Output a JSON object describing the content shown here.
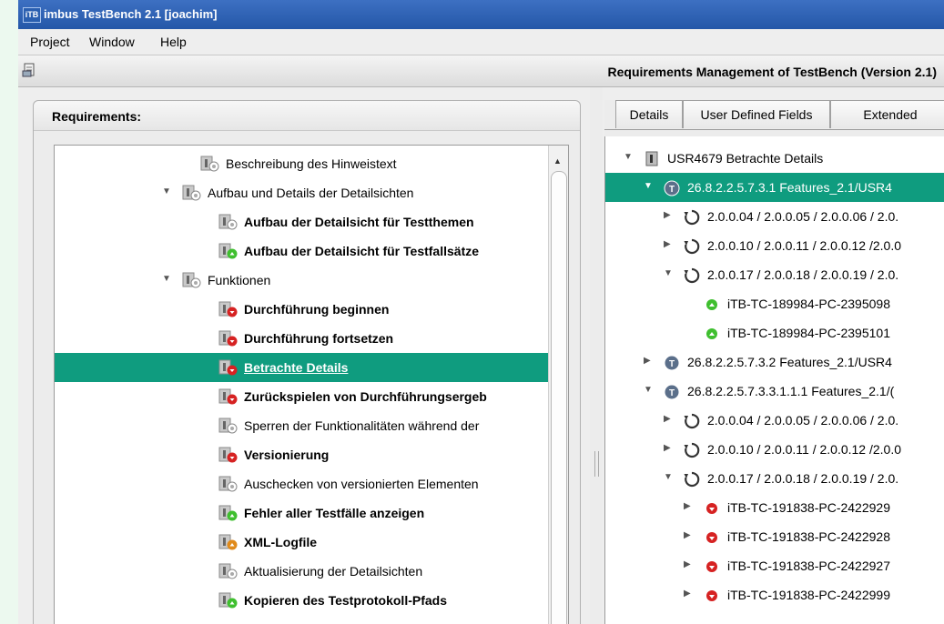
{
  "window": {
    "app_icon": "iTB",
    "title": "imbus TestBench 2.1 [joachim]"
  },
  "menu": [
    "Project",
    "Window",
    "Help"
  ],
  "header": {
    "icon": "document-icon",
    "title": "Requirements Management of TestBench (Version 2.1)"
  },
  "left_panel": {
    "title": "Requirements:",
    "items": [
      {
        "label": "Beschreibung des Hinweistext",
        "status": "gray",
        "bold": false,
        "expander": ""
      },
      {
        "label": "Aufbau und Details der Detailsichten",
        "status": "gray",
        "bold": false,
        "expander": "expanded"
      },
      {
        "label": "Aufbau der Detailsicht für Testthemen",
        "status": "gray",
        "bold": true,
        "expander": ""
      },
      {
        "label": "Aufbau der Detailsicht für Testfallsätze",
        "status": "green",
        "bold": true,
        "expander": ""
      },
      {
        "label": "Funktionen",
        "status": "gray",
        "bold": false,
        "expander": "expanded"
      },
      {
        "label": "Durchführung beginnen",
        "status": "red",
        "bold": true,
        "expander": ""
      },
      {
        "label": "Durchführung fortsetzen",
        "status": "red",
        "bold": true,
        "expander": ""
      },
      {
        "label": "Betrachte Details",
        "status": "red",
        "bold": true,
        "expander": "",
        "selected": true
      },
      {
        "label": "Zurückspielen von Durchführungsergeb",
        "status": "red",
        "bold": true,
        "expander": ""
      },
      {
        "label": "Sperren der Funktionalitäten während der",
        "status": "gray",
        "bold": false,
        "expander": ""
      },
      {
        "label": "Versionierung",
        "status": "red",
        "bold": true,
        "expander": ""
      },
      {
        "label": "Auschecken von versionierten Elementen",
        "status": "gray",
        "bold": false,
        "expander": ""
      },
      {
        "label": "Fehler aller Testfälle anzeigen",
        "status": "green",
        "bold": true,
        "expander": ""
      },
      {
        "label": "XML-Logfile",
        "status": "orange",
        "bold": true,
        "expander": ""
      },
      {
        "label": "Aktualisierung der Detailsichten",
        "status": "gray",
        "bold": false,
        "expander": ""
      },
      {
        "label": "Kopieren des Testprotokoll-Pfads",
        "status": "green",
        "bold": true,
        "expander": ""
      }
    ]
  },
  "right_panel": {
    "tabs": [
      "Details",
      "User Defined Fields",
      "Extended"
    ],
    "items": [
      {
        "label": "USR4679 Betrachte Details",
        "icon": "requirement",
        "expander": "expanded"
      },
      {
        "label": "26.8.2.2.5.7.3.1 Features_2.1/USR4",
        "icon": "topic",
        "expander": "expanded",
        "selected": true
      },
      {
        "label": "2.0.0.04 / 2.0.0.05 / 2.0.0.06 / 2.0.",
        "icon": "cycle",
        "expander": "collapsed"
      },
      {
        "label": "2.0.0.10 / 2.0.0.11 / 2.0.0.12 /2.0.0",
        "icon": "cycle",
        "expander": "collapsed"
      },
      {
        "label": "2.0.0.17 / 2.0.0.18 / 2.0.0.19 / 2.0.",
        "icon": "cycle",
        "expander": "expanded"
      },
      {
        "label": "iTB-TC-189984-PC-2395098",
        "icon": "green",
        "expander": ""
      },
      {
        "label": "iTB-TC-189984-PC-2395101",
        "icon": "green",
        "expander": ""
      },
      {
        "label": "26.8.2.2.5.7.3.2 Features_2.1/USR4",
        "icon": "topic",
        "expander": "collapsed"
      },
      {
        "label": "26.8.2.2.5.7.3.3.1.1.1 Features_2.1/(",
        "icon": "topic",
        "expander": "expanded"
      },
      {
        "label": "2.0.0.04 / 2.0.0.05 / 2.0.0.06 / 2.0.",
        "icon": "cycle",
        "expander": "collapsed"
      },
      {
        "label": "2.0.0.10 / 2.0.0.11 / 2.0.0.12 /2.0.0",
        "icon": "cycle",
        "expander": "collapsed"
      },
      {
        "label": "2.0.0.17 / 2.0.0.18 / 2.0.0.19 / 2.0.",
        "icon": "cycle",
        "expander": "expanded"
      },
      {
        "label": "iTB-TC-191838-PC-2422929",
        "icon": "red",
        "expander": "collapsed"
      },
      {
        "label": "iTB-TC-191838-PC-2422928",
        "icon": "red",
        "expander": "collapsed"
      },
      {
        "label": "iTB-TC-191838-PC-2422927",
        "icon": "red",
        "expander": "collapsed"
      },
      {
        "label": "iTB-TC-191838-PC-2422999",
        "icon": "red",
        "expander": "collapsed"
      }
    ]
  },
  "colors": {
    "selection": "#0f9c7f",
    "title_bar": "#2f64b8",
    "status_red": "#d62222",
    "status_green": "#3fbf2f",
    "status_orange": "#e08a1a"
  }
}
